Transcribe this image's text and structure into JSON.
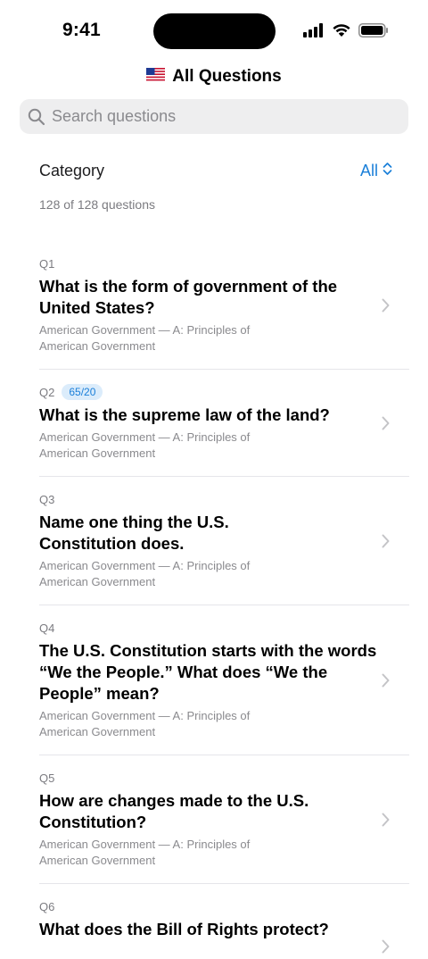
{
  "status": {
    "time": "9:41"
  },
  "nav": {
    "flag": "🇺🇸",
    "title": "All Questions"
  },
  "search": {
    "placeholder": "Search questions",
    "value": ""
  },
  "filter": {
    "label": "Category",
    "value": "All"
  },
  "count_text": "128 of 128 questions",
  "questions": [
    {
      "num": "Q1",
      "badge": "",
      "text": "What is the form of government of the United States?",
      "category": "American Government — A: Principles of American Government"
    },
    {
      "num": "Q2",
      "badge": "65/20",
      "text": "What is the supreme law of the land?",
      "category": "American Government — A: Principles of American Government"
    },
    {
      "num": "Q3",
      "badge": "",
      "text": "Name one thing the U.S. Constitution does.",
      "category": "American Government — A: Principles of American Government"
    },
    {
      "num": "Q4",
      "badge": "",
      "text": "The U.S. Constitution starts with the words “We the People.” What does “We the People” mean?",
      "category": "American Government — A: Principles of American Government"
    },
    {
      "num": "Q5",
      "badge": "",
      "text": "How are changes made to the U.S. Constitution?",
      "category": "American Government — A: Principles of American Government"
    },
    {
      "num": "Q6",
      "badge": "",
      "text": "What does the Bill of Rights protect?",
      "category": ""
    }
  ],
  "colors": {
    "accent": "#1a7fd9",
    "badge_bg": "#dbecfb",
    "secondary_text": "#8a8a8e",
    "divider": "#e5e5ea"
  },
  "icons": {
    "search": "magnifying-glass-icon",
    "chevron": "chevron-right-icon",
    "filter": "chevron-up-down-icon"
  }
}
